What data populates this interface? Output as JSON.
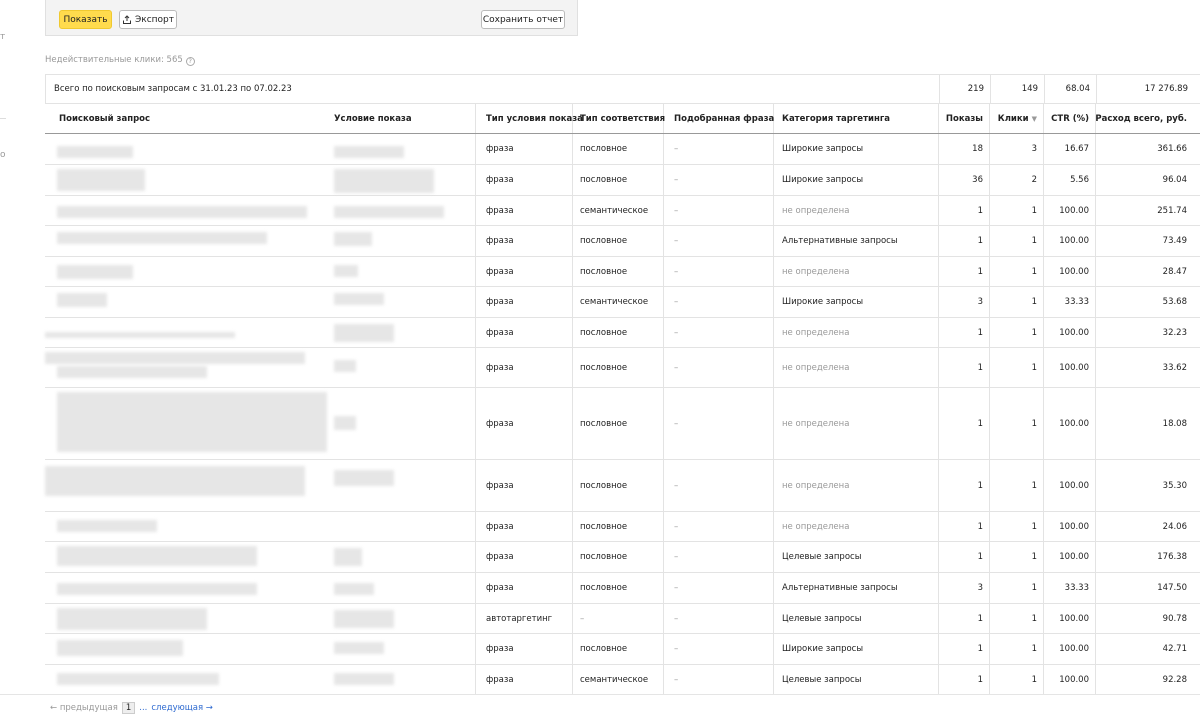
{
  "toolbar": {
    "show_label": "Показать",
    "export_label": "Экспорт",
    "save_label": "Сохранить отчет"
  },
  "invalid_clicks": "Недействительные клики: 565",
  "totals": {
    "label": "Всего по поисковым запросам с 31.01.23 по 07.02.23",
    "shows": "219",
    "clicks": "149",
    "ctr": "68.04",
    "spend": "17 276.89"
  },
  "headers": {
    "query": "Поисковый запрос",
    "condition": "Условие показа",
    "cond_type": "Тип условия показа",
    "match_type": "Тип соответствия",
    "phrase": "Подобранная фраза",
    "category": "Категория таргетинга",
    "shows": "Показы",
    "clicks": "Клики",
    "ctr": "CTR (%)",
    "spend": "Расход всего, руб."
  },
  "rows": [
    {
      "type": "фраза",
      "match": "пословное",
      "phrase": "–",
      "category": "Широкие запросы",
      "cat_muted": false,
      "shows": "18",
      "clicks": "3",
      "ctr": "16.67",
      "spend": "361.66"
    },
    {
      "type": "фраза",
      "match": "пословное",
      "phrase": "–",
      "category": "Широкие запросы",
      "cat_muted": false,
      "shows": "36",
      "clicks": "2",
      "ctr": "5.56",
      "spend": "96.04"
    },
    {
      "type": "фраза",
      "match": "семантическое",
      "phrase": "–",
      "category": "не определена",
      "cat_muted": true,
      "shows": "1",
      "clicks": "1",
      "ctr": "100.00",
      "spend": "251.74"
    },
    {
      "type": "фраза",
      "match": "пословное",
      "phrase": "–",
      "category": "Альтернативные запросы",
      "cat_muted": false,
      "shows": "1",
      "clicks": "1",
      "ctr": "100.00",
      "spend": "73.49"
    },
    {
      "type": "фраза",
      "match": "пословное",
      "phrase": "–",
      "category": "не определена",
      "cat_muted": true,
      "shows": "1",
      "clicks": "1",
      "ctr": "100.00",
      "spend": "28.47"
    },
    {
      "type": "фраза",
      "match": "семантическое",
      "phrase": "–",
      "category": "Широкие запросы",
      "cat_muted": false,
      "shows": "3",
      "clicks": "1",
      "ctr": "33.33",
      "spend": "53.68"
    },
    {
      "type": "фраза",
      "match": "пословное",
      "phrase": "–",
      "category": "не определена",
      "cat_muted": true,
      "shows": "1",
      "clicks": "1",
      "ctr": "100.00",
      "spend": "32.23"
    },
    {
      "type": "фраза",
      "match": "пословное",
      "phrase": "–",
      "category": "не определена",
      "cat_muted": true,
      "shows": "1",
      "clicks": "1",
      "ctr": "100.00",
      "spend": "33.62"
    },
    {
      "type": "фраза",
      "match": "пословное",
      "phrase": "–",
      "category": "не определена",
      "cat_muted": true,
      "shows": "1",
      "clicks": "1",
      "ctr": "100.00",
      "spend": "18.08"
    },
    {
      "type": "фраза",
      "match": "пословное",
      "phrase": "–",
      "category": "не определена",
      "cat_muted": true,
      "shows": "1",
      "clicks": "1",
      "ctr": "100.00",
      "spend": "35.30"
    },
    {
      "type": "фраза",
      "match": "пословное",
      "phrase": "–",
      "category": "не определена",
      "cat_muted": true,
      "shows": "1",
      "clicks": "1",
      "ctr": "100.00",
      "spend": "24.06"
    },
    {
      "type": "фраза",
      "match": "пословное",
      "phrase": "–",
      "category": "Целевые запросы",
      "cat_muted": false,
      "shows": "1",
      "clicks": "1",
      "ctr": "100.00",
      "spend": "176.38"
    },
    {
      "type": "фраза",
      "match": "пословное",
      "phrase": "–",
      "category": "Альтернативные запросы",
      "cat_muted": false,
      "shows": "3",
      "clicks": "1",
      "ctr": "33.33",
      "spend": "147.50"
    },
    {
      "type": "автотаргетинг",
      "match": "–",
      "phrase": "–",
      "category": "Целевые запросы",
      "cat_muted": false,
      "shows": "1",
      "clicks": "1",
      "ctr": "100.00",
      "spend": "90.78"
    },
    {
      "type": "фраза",
      "match": "пословное",
      "phrase": "–",
      "category": "Широкие запросы",
      "cat_muted": false,
      "shows": "1",
      "clicks": "1",
      "ctr": "100.00",
      "spend": "42.71"
    },
    {
      "type": "фраза",
      "match": "семантическое",
      "phrase": "–",
      "category": "Целевые запросы",
      "cat_muted": false,
      "shows": "1",
      "clicks": "1",
      "ctr": "100.00",
      "spend": "92.28"
    }
  ],
  "pager": {
    "prev": "← предыдущая",
    "page": "1",
    "dots": "...",
    "next": "следующая →"
  }
}
